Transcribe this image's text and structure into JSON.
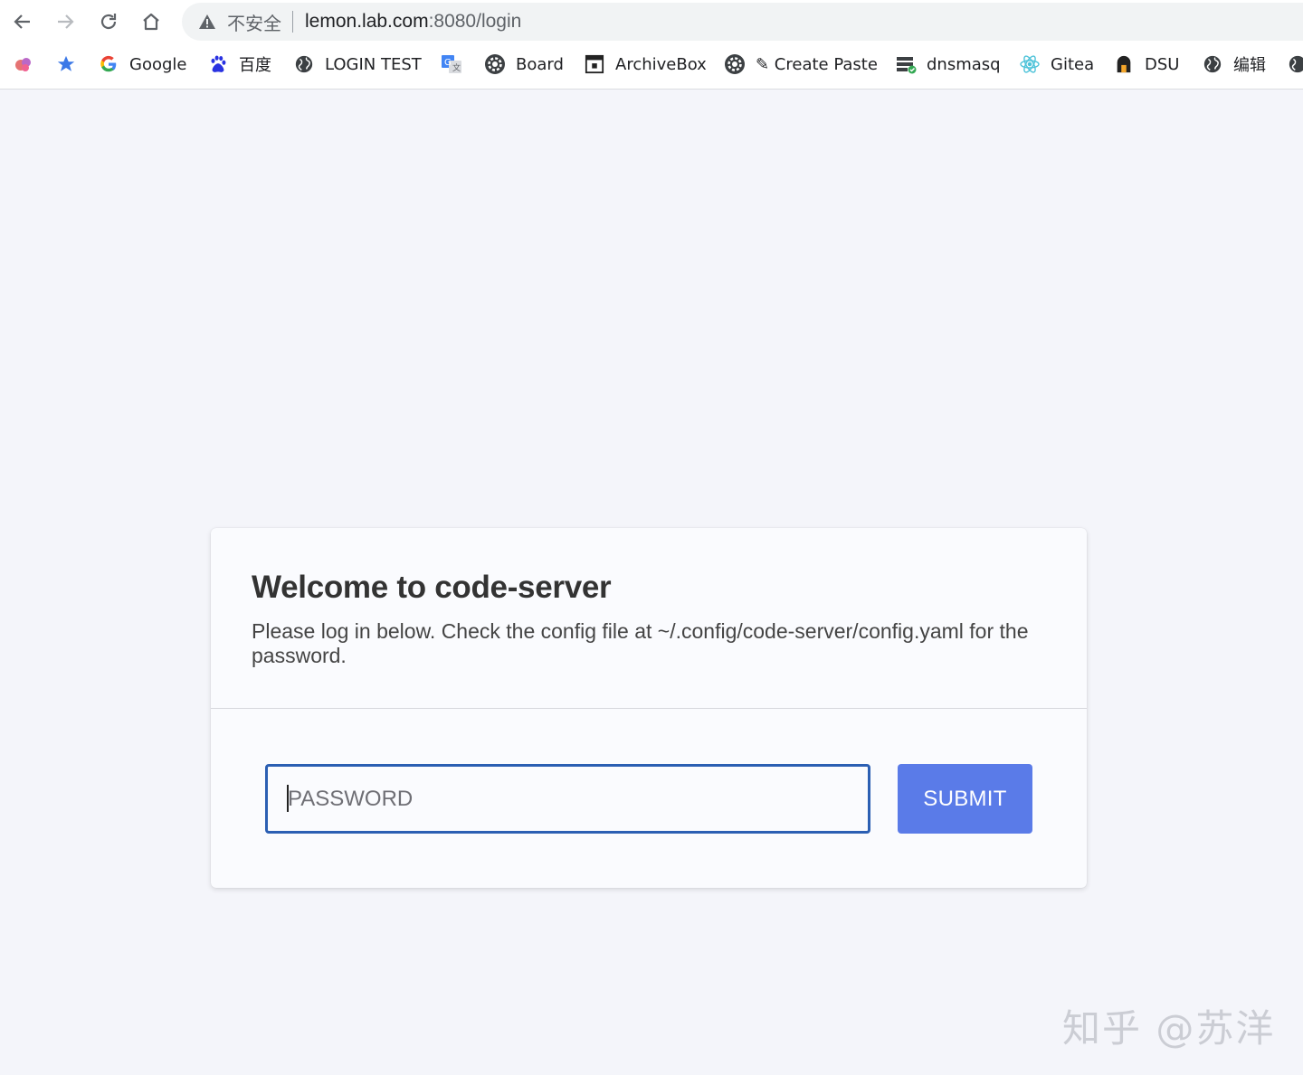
{
  "browser": {
    "security_label": "不安全",
    "url_host": "lemon.lab.com",
    "url_rest": ":8080/login",
    "bookmarks": [
      {
        "icon": "colorful-app-icon",
        "label": ""
      },
      {
        "icon": "star-icon",
        "label": ""
      },
      {
        "icon": "google-icon",
        "label": "Google"
      },
      {
        "icon": "baidu-paw-icon",
        "label": "百度"
      },
      {
        "icon": "globe-icon",
        "label": "LOGIN TEST"
      },
      {
        "icon": "translate-icon",
        "label": ""
      },
      {
        "icon": "gear-icon",
        "label": "Board"
      },
      {
        "icon": "archive-icon",
        "label": "ArchiveBox"
      },
      {
        "icon": "gear-icon",
        "label": "✎ Create Paste"
      },
      {
        "icon": "server-icon",
        "label": "dnsmasq"
      },
      {
        "icon": "atom-icon",
        "label": "Gitea"
      },
      {
        "icon": "house-icon",
        "label": "DSU"
      },
      {
        "icon": "globe-icon",
        "label": "编辑"
      },
      {
        "icon": "globe-icon",
        "label": ""
      }
    ]
  },
  "login": {
    "title": "Welcome to code-server",
    "subtitle": "Please log in below. Check the config file at ~/.config/code-server/config.yaml for the password.",
    "password_placeholder": "PASSWORD",
    "submit_label": "SUBMIT"
  },
  "watermark": "知乎 @苏洋",
  "colors": {
    "page_bg": "#f4f5fa",
    "card_bg": "#fafbfe",
    "input_border": "#2b5fb3",
    "submit_bg": "#5a7be8"
  }
}
